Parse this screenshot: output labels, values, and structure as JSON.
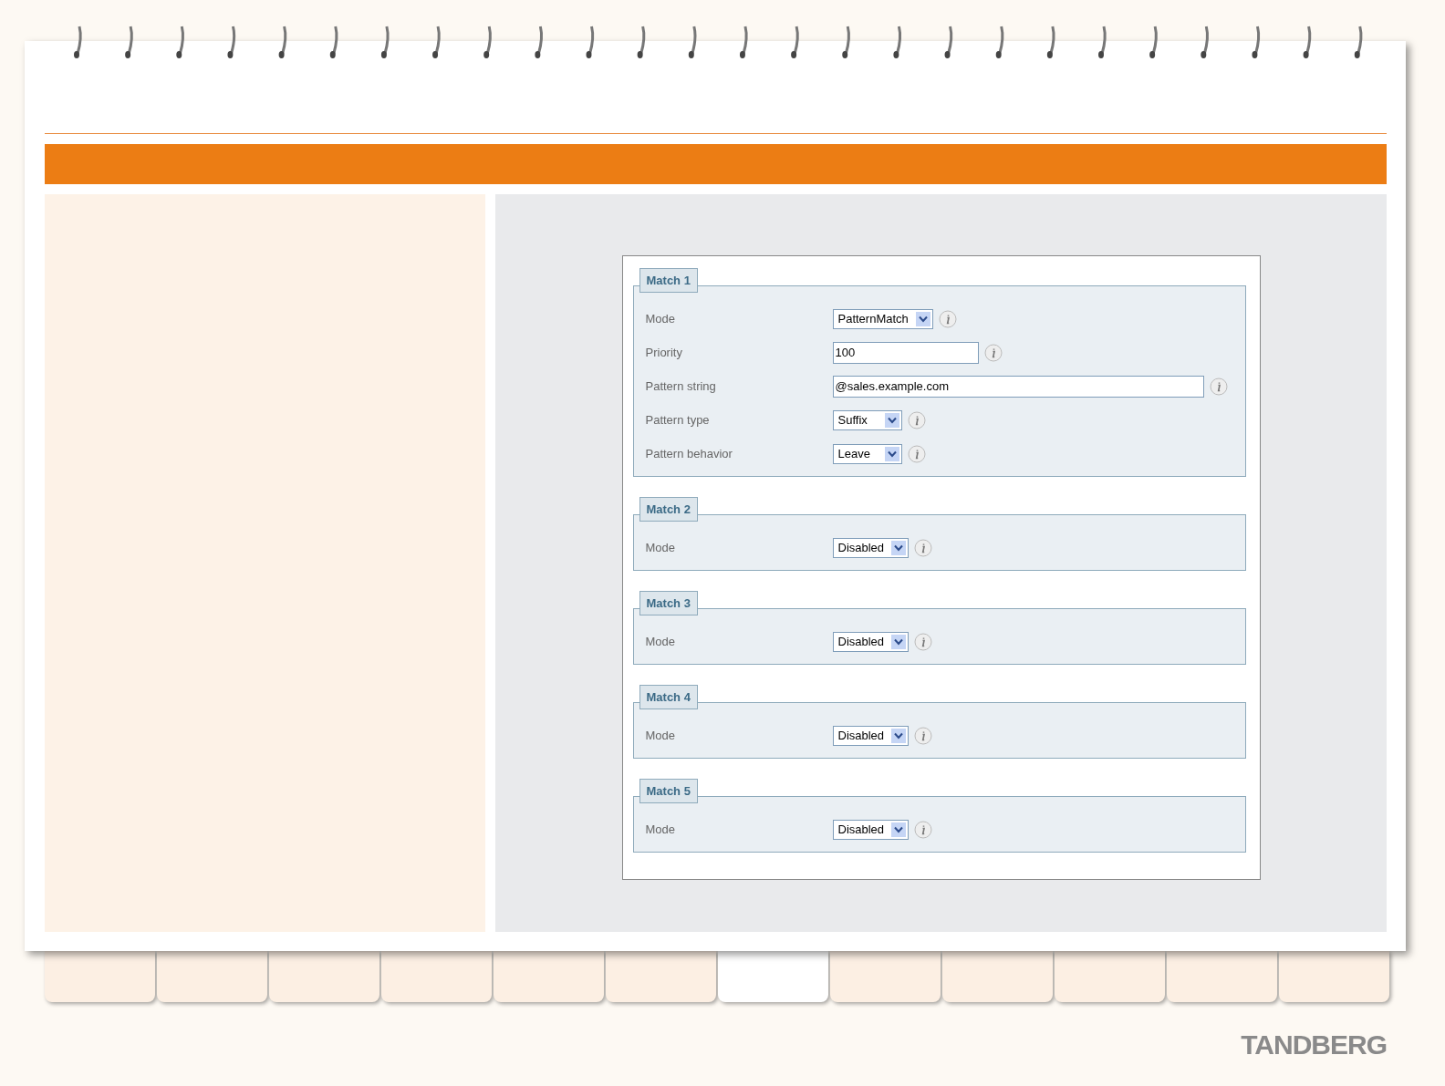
{
  "form": {
    "matches": [
      {
        "legend": "Match 1",
        "rows": [
          {
            "label": "Mode",
            "kind": "select",
            "value": "PatternMatch"
          },
          {
            "label": "Priority",
            "kind": "short-input",
            "value": "100"
          },
          {
            "label": "Pattern string",
            "kind": "long-input",
            "value": "@sales.example.com"
          },
          {
            "label": "Pattern type",
            "kind": "select",
            "value": "Suffix"
          },
          {
            "label": "Pattern behavior",
            "kind": "select",
            "value": "Leave"
          }
        ]
      },
      {
        "legend": "Match 2",
        "rows": [
          {
            "label": "Mode",
            "kind": "select",
            "value": "Disabled"
          }
        ]
      },
      {
        "legend": "Match 3",
        "rows": [
          {
            "label": "Mode",
            "kind": "select",
            "value": "Disabled"
          }
        ]
      },
      {
        "legend": "Match 4",
        "rows": [
          {
            "label": "Mode",
            "kind": "select",
            "value": "Disabled"
          }
        ]
      },
      {
        "legend": "Match 5",
        "rows": [
          {
            "label": "Mode",
            "kind": "select",
            "value": "Disabled"
          }
        ]
      }
    ]
  },
  "tabs": [
    {
      "selected": false
    },
    {
      "selected": false
    },
    {
      "selected": false
    },
    {
      "selected": false
    },
    {
      "selected": false
    },
    {
      "selected": false
    },
    {
      "selected": true
    },
    {
      "selected": false
    },
    {
      "selected": false
    },
    {
      "selected": false
    },
    {
      "selected": false
    },
    {
      "selected": false
    }
  ],
  "logo": "TANDBERG"
}
